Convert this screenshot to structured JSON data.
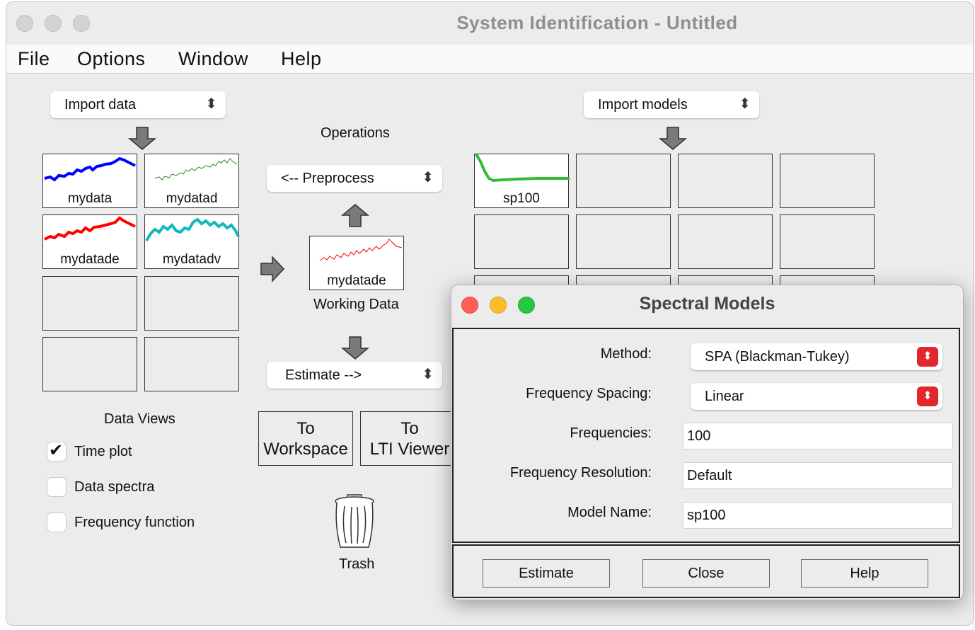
{
  "window": {
    "title": "System Identification - Untitled"
  },
  "menu": {
    "file": "File",
    "options": "Options",
    "window": "Window",
    "help": "Help"
  },
  "import_data": {
    "label": "Import data"
  },
  "import_models": {
    "label": "Import models"
  },
  "data_slots": [
    {
      "label": "mydata",
      "color": "#0000ff"
    },
    {
      "label": "mydatad",
      "color": "#2a8a2a"
    },
    {
      "label": "mydatade",
      "color": "#ff0000"
    },
    {
      "label": "mydatadv",
      "color": "#14b8b8"
    }
  ],
  "operations": {
    "title": "Operations",
    "preprocess": "<-- Preprocess",
    "working_data_label": "mydatade",
    "working_data_caption": "Working Data",
    "estimate": "Estimate -->",
    "to_workspace_line1": "To",
    "to_workspace_line2": "Workspace",
    "to_lti_line1": "To",
    "to_lti_line2": "LTI Viewer",
    "trash": "Trash"
  },
  "model_slots": [
    {
      "label": "sp100",
      "color": "#33bb33"
    }
  ],
  "data_views": {
    "title": "Data Views",
    "time_plot": "Time plot",
    "data_spectra": "Data spectra",
    "frequency_function": "Frequency function",
    "time_plot_checked": true,
    "data_spectra_checked": false,
    "frequency_function_checked": false
  },
  "dialog": {
    "title": "Spectral Models",
    "method_label": "Method:",
    "method_value": "SPA (Blackman-Tukey)",
    "spacing_label": "Frequency Spacing:",
    "spacing_value": "Linear",
    "frequencies_label": "Frequencies:",
    "frequencies_value": "100",
    "resolution_label": "Frequency Resolution:",
    "resolution_value": "Default",
    "model_name_label": "Model Name:",
    "model_name_value": "sp100",
    "estimate_button": "Estimate",
    "close_button": "Close",
    "help_button": "Help"
  }
}
